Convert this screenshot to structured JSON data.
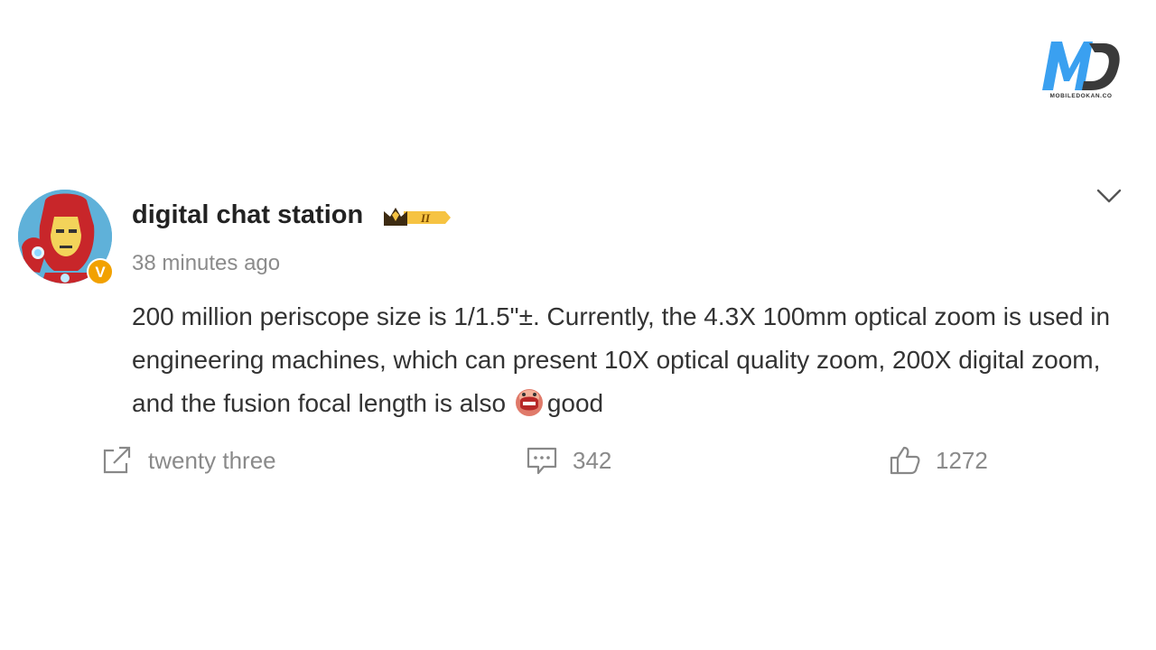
{
  "brand": {
    "logo_caption": "MOBILEDOKAN.CO"
  },
  "post": {
    "username": "digital chat station",
    "member_level": "II",
    "verified_badge": "V",
    "timestamp": "38 minutes ago",
    "text": "200 million periscope size is 1/1.5\"±. Currently, the 4.3X 100mm optical zoom is used in engineering machines, which can present 10X optical quality zoom, 200X digital zoom, and the fusion focal length is also ",
    "text_end": "good",
    "actions": {
      "share_count": "twenty three",
      "comment_count": "342",
      "like_count": "1272"
    }
  },
  "colors": {
    "logo_blue": "#3aa0f0",
    "logo_dark": "#333333",
    "badge_orange": "#f2a100",
    "muted_text": "#8a8a8a"
  },
  "icons": [
    "chevron-down-icon",
    "share-icon",
    "comment-icon",
    "like-icon",
    "crown-icon"
  ]
}
